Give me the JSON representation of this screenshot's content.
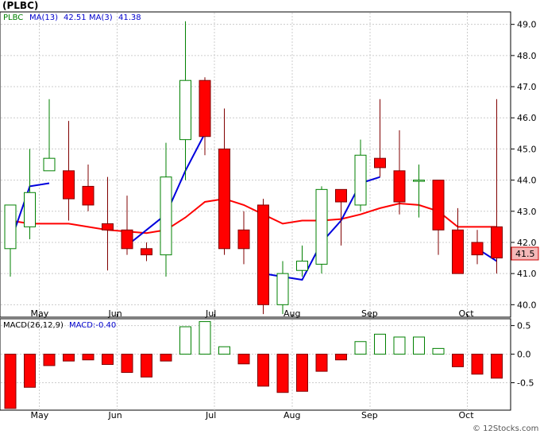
{
  "header": {
    "title": "(PLBC)",
    "legend": [
      {
        "text": "PLBC",
        "color": "#008000"
      },
      {
        "text": "MA(13)",
        "color": "#0000cc"
      },
      {
        "text": "42.51",
        "color": "#0000cc"
      },
      {
        "text": "MA(3)",
        "color": "#0000cc"
      },
      {
        "text": "41.38",
        "color": "#0000cc"
      }
    ]
  },
  "macd_header": {
    "legend": [
      {
        "text": "MACD(26,12,9)",
        "color": "#000000"
      },
      {
        "text": "MACD:-0.40",
        "color": "#0000cc"
      }
    ]
  },
  "footer": {
    "watermark": "© 12Stocks.com"
  },
  "colors": {
    "up_candle_fill": "#ffffff",
    "up_candle_stroke": "#008000",
    "down_candle_fill": "#ff0000",
    "down_candle_stroke": "#800000",
    "ma13": "#ff0000",
    "ma3": "#0000dd",
    "last_price_box": "#f4b8b8"
  },
  "chart_data": [
    {
      "type": "candlestick",
      "name": "price",
      "x_ticks": [
        "May",
        "Jun",
        "Jul",
        "Aug",
        "Sep",
        "Oct"
      ],
      "y_ticks": [
        "40.0",
        "41.0",
        "42.0",
        "43.0",
        "44.0",
        "45.0",
        "46.0",
        "47.0",
        "48.0",
        "49.0"
      ],
      "ylim": [
        39.6,
        49.4
      ],
      "last_price_label": "41.5",
      "candles": [
        {
          "open": 41.8,
          "high": 42.6,
          "low": 40.9,
          "close": 43.2
        },
        {
          "open": 42.5,
          "high": 45.0,
          "low": 42.1,
          "close": 43.6
        },
        {
          "open": 44.3,
          "high": 46.6,
          "low": 44.3,
          "close": 44.7
        },
        {
          "open": 44.3,
          "high": 45.9,
          "low": 42.7,
          "close": 43.4
        },
        {
          "open": 43.8,
          "high": 44.5,
          "low": 43.0,
          "close": 43.2
        },
        {
          "open": 42.6,
          "high": 44.1,
          "low": 41.1,
          "close": 42.4
        },
        {
          "open": 42.4,
          "high": 43.5,
          "low": 41.6,
          "close": 41.8
        },
        {
          "open": 41.8,
          "high": 42.0,
          "low": 41.4,
          "close": 41.6
        },
        {
          "open": 41.6,
          "high": 45.2,
          "low": 40.9,
          "close": 44.1
        },
        {
          "open": 45.3,
          "high": 49.1,
          "low": 44.0,
          "close": 47.2
        },
        {
          "open": 47.2,
          "high": 47.3,
          "low": 44.8,
          "close": 45.4
        },
        {
          "open": 45.0,
          "high": 46.3,
          "low": 41.6,
          "close": 41.8
        },
        {
          "open": 42.4,
          "high": 43.0,
          "low": 41.3,
          "close": 41.8
        },
        {
          "open": 43.2,
          "high": 43.4,
          "low": 39.7,
          "close": 40.0
        },
        {
          "open": 40.0,
          "high": 41.4,
          "low": 39.7,
          "close": 41.0
        },
        {
          "open": 41.1,
          "high": 41.9,
          "low": 40.9,
          "close": 41.4
        },
        {
          "open": 41.3,
          "high": 43.8,
          "low": 41.0,
          "close": 43.7
        },
        {
          "open": 43.7,
          "high": 43.7,
          "low": 41.9,
          "close": 43.3
        },
        {
          "open": 43.2,
          "high": 45.3,
          "low": 43.0,
          "close": 44.8
        },
        {
          "open": 44.7,
          "high": 46.6,
          "low": 44.1,
          "close": 44.4
        },
        {
          "open": 44.3,
          "high": 45.6,
          "low": 42.9,
          "close": 43.3
        },
        {
          "open": 44.0,
          "high": 44.5,
          "low": 42.8,
          "close": 44.0
        },
        {
          "open": 44.0,
          "high": 44.0,
          "low": 41.6,
          "close": 42.4
        },
        {
          "open": 42.4,
          "high": 43.1,
          "low": 41.0,
          "close": 41.0
        },
        {
          "open": 42.0,
          "high": 42.4,
          "low": 41.3,
          "close": 41.6
        },
        {
          "open": 42.5,
          "high": 46.6,
          "low": 41.0,
          "close": 41.5
        }
      ],
      "ma13": [
        42.7,
        42.6,
        42.6,
        42.6,
        42.5,
        42.4,
        42.35,
        42.3,
        42.4,
        42.8,
        43.3,
        43.4,
        43.2,
        42.9,
        42.6,
        42.7,
        42.7,
        42.75,
        42.9,
        43.1,
        43.25,
        43.2,
        43.0,
        42.5,
        42.5,
        42.5
      ],
      "ma3": [
        42.0,
        43.8,
        43.9,
        null,
        null,
        null,
        41.9,
        42.4,
        42.9,
        44.3,
        45.5,
        null,
        null,
        41.0,
        40.9,
        40.8,
        42.0,
        42.7,
        43.9,
        44.1,
        null,
        null,
        null,
        null,
        41.8,
        41.4
      ]
    },
    {
      "type": "bar",
      "name": "MACD(26,12,9)",
      "y_ticks": [
        "0.5",
        "0.0",
        "-0.5"
      ],
      "ylim": [
        -0.98,
        0.62
      ],
      "values": [
        -0.95,
        -0.58,
        -0.2,
        -0.12,
        -0.1,
        -0.18,
        -0.32,
        -0.4,
        -0.12,
        0.48,
        0.57,
        0.13,
        -0.17,
        -0.56,
        -0.67,
        -0.65,
        -0.3,
        -0.1,
        0.22,
        0.35,
        0.3,
        0.3,
        0.1,
        -0.22,
        -0.35,
        -0.42
      ]
    }
  ]
}
